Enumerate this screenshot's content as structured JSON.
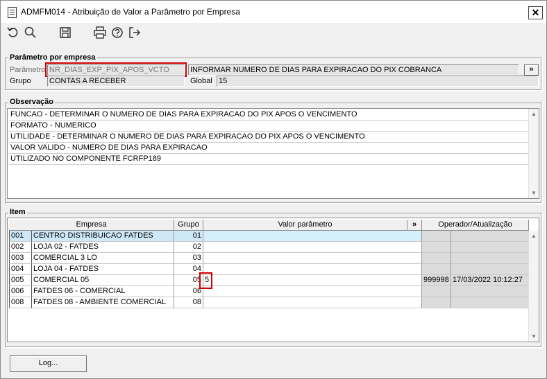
{
  "window": {
    "title": "ADMFM014 - Atribuição de Valor a Parâmetro por Empresa",
    "close": "✕"
  },
  "toolbar": {
    "icons": [
      "undo-icon",
      "search-icon",
      "save-icon",
      "print-icon",
      "help-icon",
      "exit-icon"
    ]
  },
  "param": {
    "group_label": "Parâmetro por empresa",
    "parametro_label": "Parâmetro",
    "parametro_value": "NR_DIAS_EXP_PIX_APOS_VCTO",
    "description": "INFORMAR NUMERO DE DIAS PARA EXPIRACAO DO PIX COBRANCA",
    "expand_label": "»",
    "grupo_label": "Grupo",
    "grupo_value": "CONTAS A RECEBER",
    "global_label": "Global",
    "global_value": "15"
  },
  "obs": {
    "group_label": "Observação",
    "lines": [
      "FUNCAO - DETERMINAR O NUMERO DE DIAS PARA EXPIRACAO DO PIX APOS O VENCIMENTO",
      "FORMATO - NUMERICO",
      "UTILIDADE - DETERMINAR O NUMERO DE DIAS PARA EXPIRACAO DO PIX APOS O VENCIMENTO",
      "VALOR VALIDO - NUMERO DE DIAS PARA EXPIRACAO",
      "UTILIZADO NO COMPONENTE FCRFP189"
    ]
  },
  "item": {
    "group_label": "Item",
    "headers": {
      "empresa": "Empresa",
      "grupo": "Grupo",
      "valor": "Valor parâmetro",
      "expand": "»",
      "operador": "Operador/Atualização"
    },
    "rows": [
      {
        "code": "001",
        "empresa": "CENTRO DISTRIBUICAO FATDES",
        "grupo": "01",
        "valor": "",
        "operador": "",
        "data": ""
      },
      {
        "code": "002",
        "empresa": "LOJA 02 - FATDES",
        "grupo": "02",
        "valor": "",
        "operador": "",
        "data": ""
      },
      {
        "code": "003",
        "empresa": "COMERCIAL 3 LO",
        "grupo": "03",
        "valor": "",
        "operador": "",
        "data": ""
      },
      {
        "code": "004",
        "empresa": "LOJA 04 - FATDES",
        "grupo": "04",
        "valor": "",
        "operador": "",
        "data": ""
      },
      {
        "code": "005",
        "empresa": "COMERCIAL 05",
        "grupo": "05",
        "valor": "5",
        "operador": "999998",
        "data": "17/03/2022 10:12:27"
      },
      {
        "code": "006",
        "empresa": "FATDES 06 - COMERCIAL",
        "grupo": "06",
        "valor": "",
        "operador": "",
        "data": ""
      },
      {
        "code": "008",
        "empresa": "FATDES 08 - AMBIENTE COMERCIAL",
        "grupo": "08",
        "valor": "",
        "operador": "",
        "data": ""
      }
    ]
  },
  "footer": {
    "log_label": "Log..."
  }
}
